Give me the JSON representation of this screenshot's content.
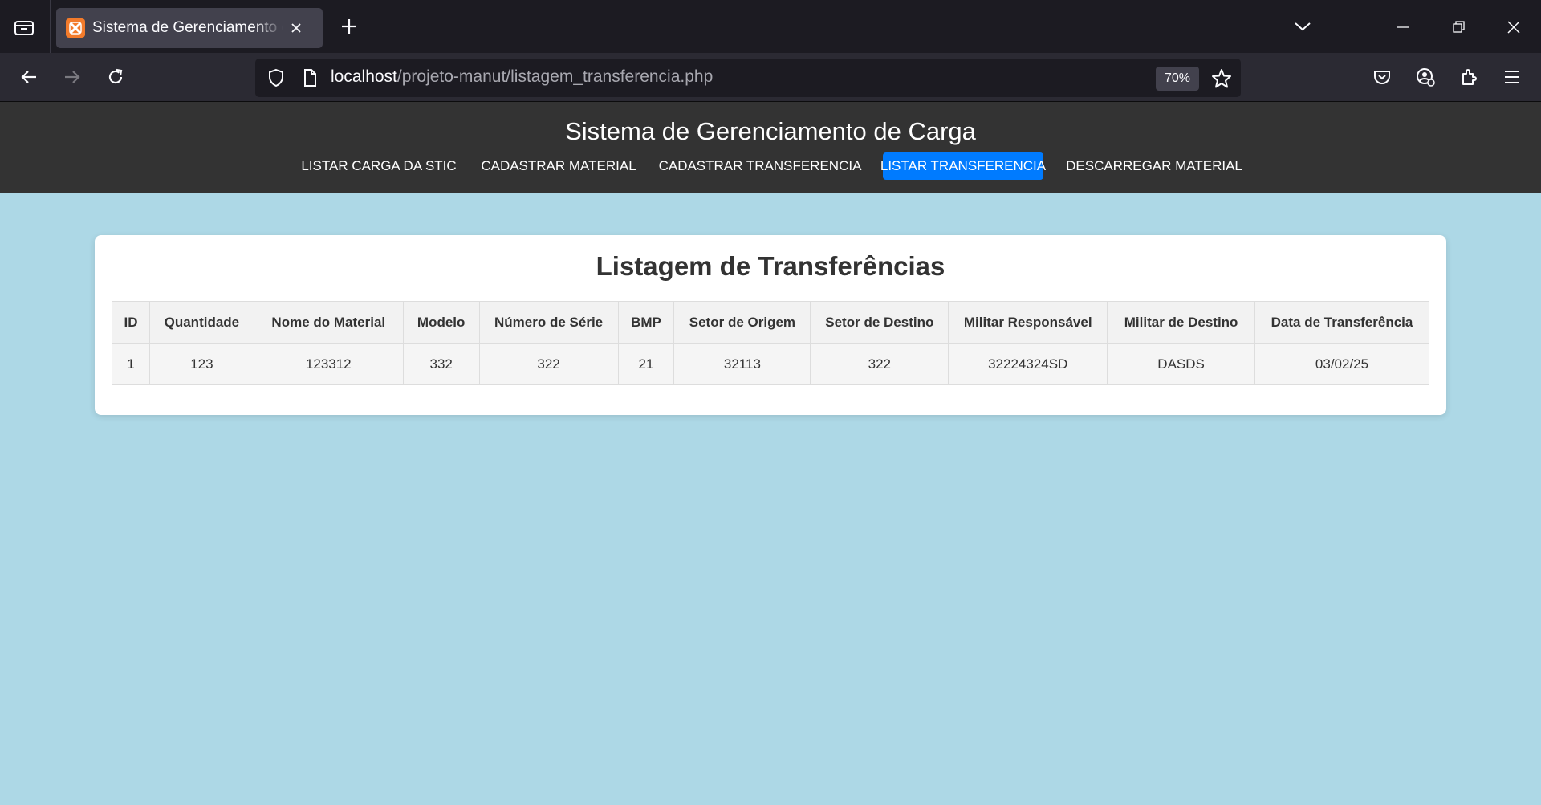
{
  "browser": {
    "tab_title": "Sistema de Gerenciamento de Carga",
    "url_host": "localhost",
    "url_path": "/projeto-manut/listagem_transferencia.php",
    "zoom": "70%"
  },
  "header": {
    "title": "Sistema de Gerenciamento de Carga",
    "menu": [
      {
        "label": "LISTAR CARGA DA STIC",
        "active": false
      },
      {
        "label": "CADASTRAR MATERIAL",
        "active": false
      },
      {
        "label": "CADASTRAR TRANSFERENCIA",
        "active": false
      },
      {
        "label": "LISTAR TRANSFERENCIA",
        "active": true
      },
      {
        "label": "DESCARREGAR MATERIAL",
        "active": false
      }
    ]
  },
  "main": {
    "title": "Listagem de Transferências",
    "table": {
      "columns": [
        "ID",
        "Quantidade",
        "Nome do Material",
        "Modelo",
        "Número de Série",
        "BMP",
        "Setor de Origem",
        "Setor de Destino",
        "Militar Responsável",
        "Militar de Destino",
        "Data de Transferência"
      ],
      "rows": [
        [
          "1",
          "123",
          "123312",
          "332",
          "322",
          "21",
          "32113",
          "322",
          "32224324SD",
          "DASDS",
          "03/02/25"
        ]
      ]
    }
  },
  "colors": {
    "page_background": "#add8e6",
    "header_background": "#333333",
    "active_menu": "#007bff"
  },
  "icons": [
    "tab-overview-icon",
    "xampp-favicon-icon",
    "close-icon",
    "plus-icon",
    "chevron-down-icon",
    "minimize-icon",
    "restore-icon",
    "back-arrow-icon",
    "forward-arrow-icon",
    "reload-icon",
    "shield-icon",
    "page-icon",
    "star-icon",
    "pocket-icon",
    "account-icon",
    "extensions-icon",
    "menu-icon"
  ]
}
